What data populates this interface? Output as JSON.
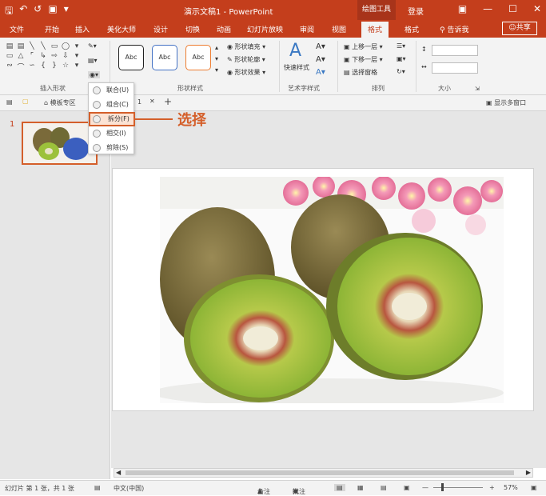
{
  "title_bar": {
    "doc_title": "演示文稿1 - PowerPoint",
    "context_group": "绘图工具",
    "login": "登录",
    "qat_icons": [
      "save-icon",
      "undo-icon",
      "redo-icon",
      "start-from-beginning-icon",
      "customize-qat-icon"
    ],
    "window_icons": [
      "ribbon-display-options-icon",
      "minimize-icon",
      "maximize-icon",
      "close-icon"
    ]
  },
  "tabs": [
    "文件",
    "开始",
    "插入",
    "美化大师",
    "设计",
    "切换",
    "动画",
    "幻灯片放映",
    "审阅",
    "视图",
    "格式",
    "格式"
  ],
  "active_tab": "格式",
  "tell_me": "告诉我",
  "share": "共享",
  "ribbon": {
    "insert_shapes_label": "插入形状",
    "shape_styles_label": "形状样式",
    "style_preview_text": [
      "Abc",
      "Abc",
      "Abc"
    ],
    "fill": "形状填充",
    "outline": "形状轮廓",
    "effects": "形状效果",
    "wordart_label": "艺术字样式",
    "quick_styles": "快速样式",
    "arrange_label": "排列",
    "bring_forward": "上移一层",
    "send_backward": "下移一层",
    "selection_pane": "选择窗格",
    "size_label": "大小"
  },
  "merge_menu": {
    "items": [
      "联合(U)",
      "组合(C)",
      "拆分(F)",
      "相交(I)",
      "剪除(S)"
    ],
    "highlighted": "拆分(F)"
  },
  "callout_text": "选择",
  "doc_tabs": {
    "template": "模板专区",
    "doc_tab_suffix": "1",
    "show_multi_window": "显示多窗口"
  },
  "slide_number": "1",
  "status": {
    "slide_info": "幻灯片 第 1 张，共 1 张",
    "language": "中文(中国)",
    "notes": "备注",
    "comments": "批注",
    "zoom": "57%"
  },
  "colors": {
    "accent": "#c43e1c",
    "highlight": "#d45f2a"
  }
}
